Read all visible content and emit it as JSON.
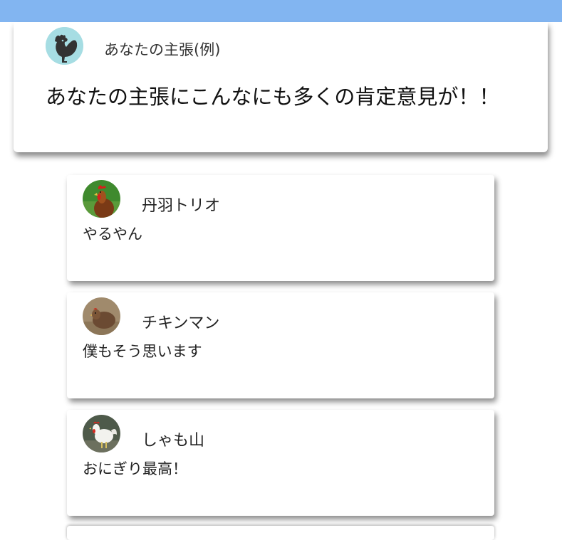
{
  "header": {
    "accent_color": "#82b5f1"
  },
  "post": {
    "author": "あなたの主張(例)",
    "avatar_icon": "rooster-silhouette-icon",
    "text": "あなたの主張にこんなにも多くの肯定意見が！！"
  },
  "replies": [
    {
      "author": "丹羽トリオ",
      "avatar_icon": "brown-rooster-photo",
      "text": "やるやん"
    },
    {
      "author": "チキンマン",
      "avatar_icon": "hen-photo",
      "text": "僕もそう思います"
    },
    {
      "author": "しゃも山",
      "avatar_icon": "white-rooster-photo",
      "text": "おにぎり最高！"
    }
  ]
}
